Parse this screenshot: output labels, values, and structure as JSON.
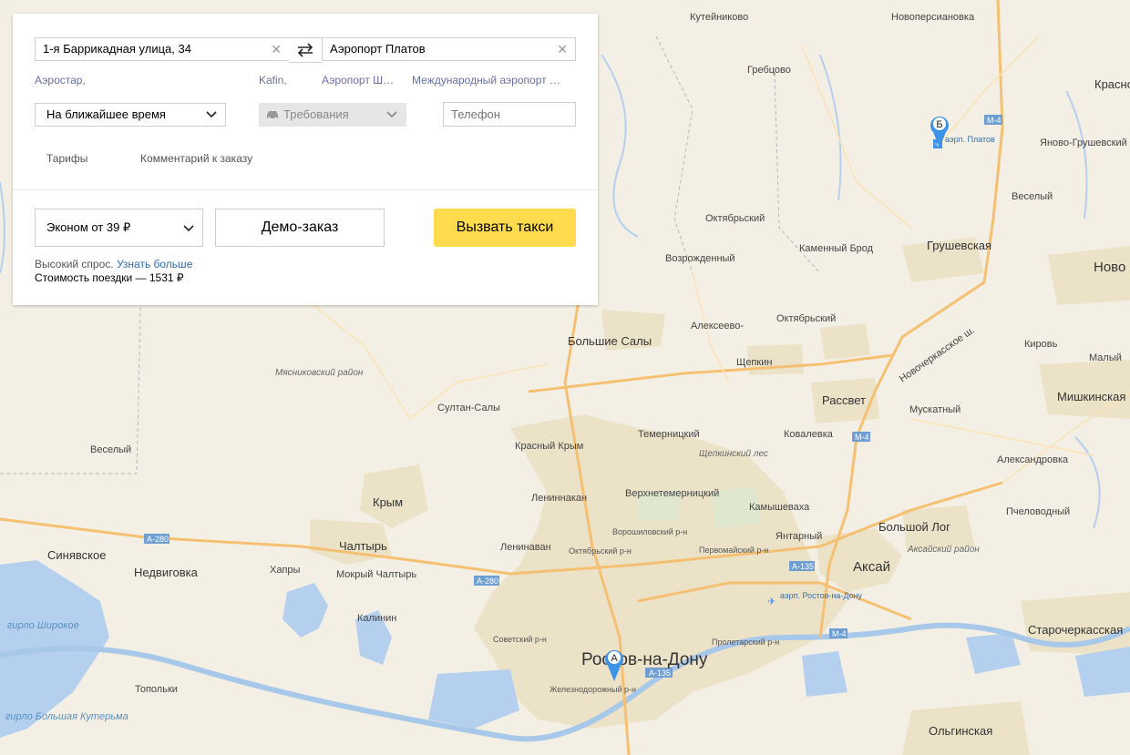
{
  "order": {
    "from_value": "1-я Баррикадная улица, 34",
    "to_value": "Аэропорт Платов",
    "suggestions": [
      "Аэростар,",
      "Kafin,",
      "Аэропорт Ш…",
      "Международный аэропорт …"
    ],
    "time_label": "На ближайшее время",
    "requirements_label": "Требования",
    "phone_placeholder": "Телефон",
    "tariffs_link": "Тарифы",
    "comment_link": "Комментарий к заказу",
    "tariff_select": "Эконом от 39 ₽",
    "demo_button": "Демо-заказ",
    "call_button": "Вызвать такси",
    "demand_text": "Высокий спрос.",
    "learn_more": "Узнать больше",
    "price_text": "Стоимость поездки — 1531 ₽"
  },
  "markers": {
    "start": "А",
    "end": "Б"
  },
  "colors": {
    "accent": "#ffdb4d",
    "water": "#b5d0ee",
    "road": "#f6c072",
    "marker": "#3d93e8"
  },
  "map": {
    "labels_big": [
      "Ростов-на-Дону",
      "Аксай",
      "Большие Салы",
      "Крым",
      "Чалтырь",
      "Недвиговка",
      "Синявское",
      "Большой Лог",
      "Грушевская",
      "Рассвет",
      "Ново",
      "Краснодар",
      "Мишкинская",
      "Старочеркасская",
      "Ольгинская"
    ],
    "labels_med": [
      "Кутейниково",
      "Новоперсиановка",
      "Гребцово",
      "Октябрьский",
      "Каменный Брод",
      "Возрожденный",
      "Веселый",
      "Яново-Грушевский",
      "Алексеево-",
      "Щепкин",
      "Октябрьский",
      "Кировь",
      "Малый",
      "Султан-Салы",
      "Темерницкий",
      "Ковалевка",
      "Мускатный",
      "Красный Крым",
      "Лениннакан",
      "Верхнетемерницкий",
      "Камышеваха",
      "Александровка",
      "Пчеловодный",
      "Ленинаван",
      "Янтарный",
      "Веселый",
      "Хапры",
      "Мокрый Чалтырь",
      "Калинин",
      "Топольки",
      "Кировъ"
    ],
    "districts": [
      "Мясниковский район",
      "Щепкинский лес",
      "Аксайский район"
    ],
    "city_districts": [
      "Ворошиловский р-н",
      "Октябрьский р-н",
      "Первомайский р-н",
      "Советский р-н",
      "Железнодорожный р-н",
      "Пролетарский р-н"
    ],
    "roads": [
      "М-4",
      "А-280",
      "А-135",
      "Новочеркасское ш."
    ],
    "airport_labels": [
      "аэрп. Платов",
      "аэрп. Ростов-на-Дону"
    ],
    "water_labels": [
      "гирло Широкое",
      "гирло Большая Кутерьма"
    ]
  }
}
